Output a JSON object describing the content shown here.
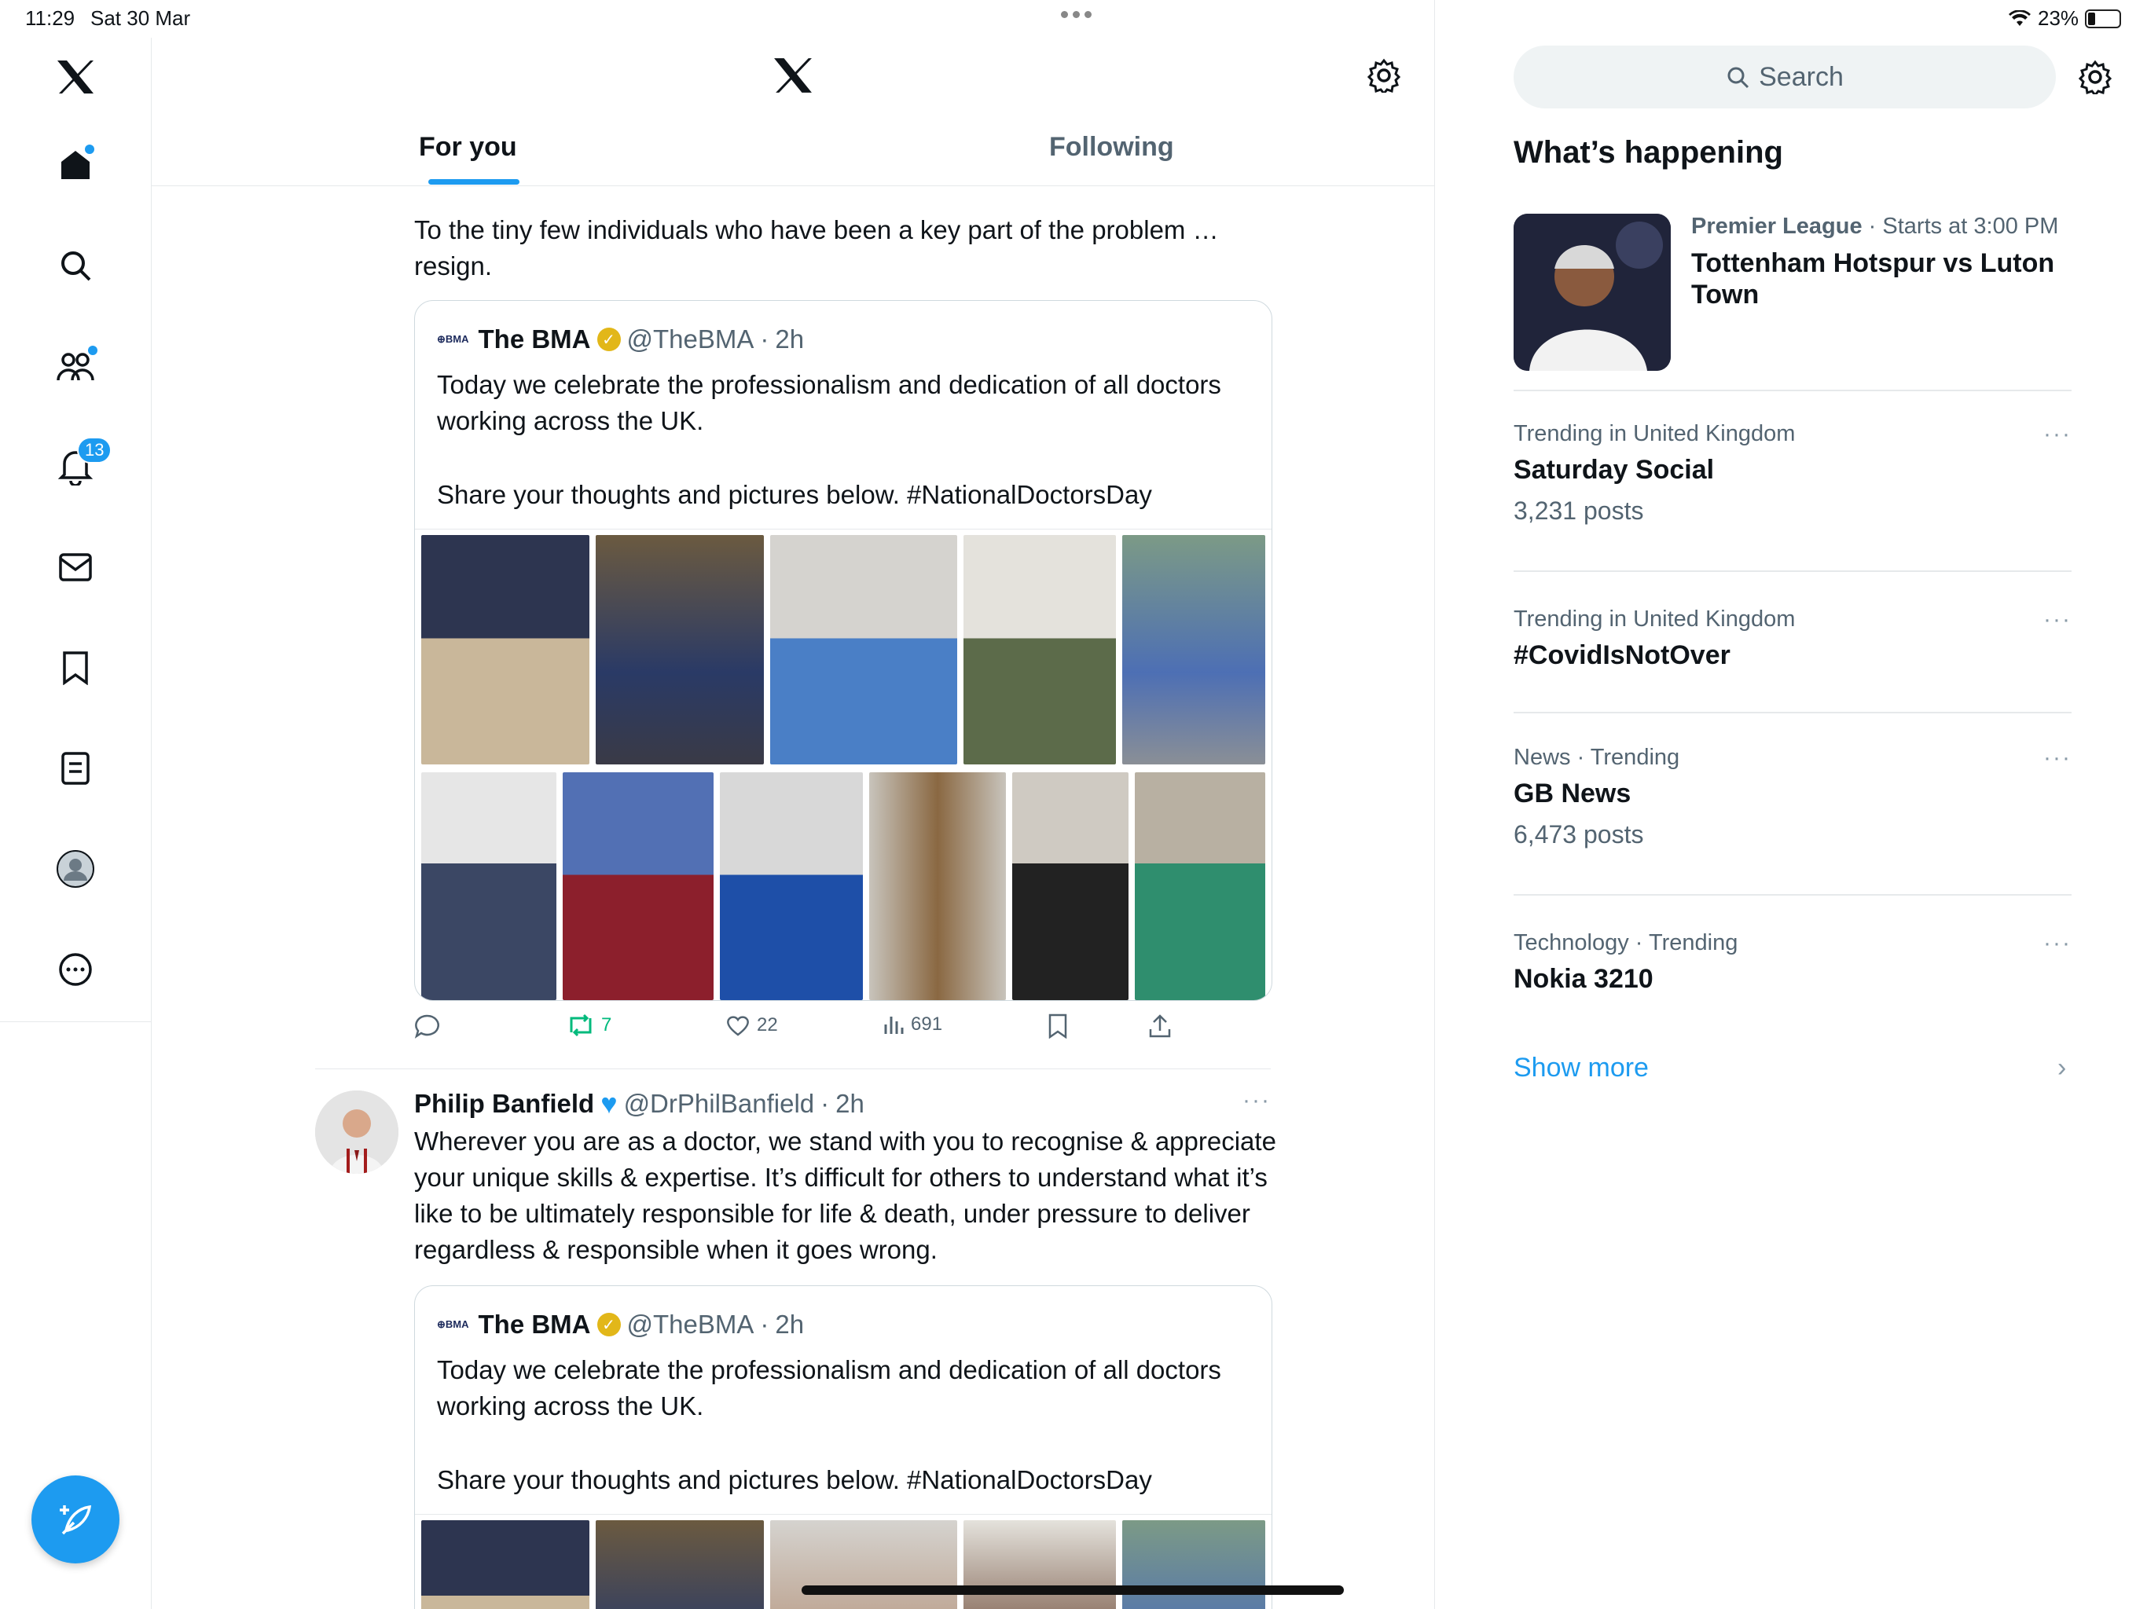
{
  "status_bar": {
    "time": "11:29",
    "date": "Sat 30 Mar",
    "battery": "23%"
  },
  "nav": {
    "items": [
      "home",
      "explore",
      "communities",
      "notifications",
      "messages",
      "bookmarks",
      "lists",
      "profile",
      "more"
    ],
    "notifications_badge": "13"
  },
  "header": {
    "tab_for_you": "For you",
    "tab_following": "Following"
  },
  "feed": {
    "post1": {
      "text": "To the tiny few individuals who have been a key part of the problem … resign.",
      "quote": {
        "name": "The BMA",
        "handle": "@TheBMA",
        "time": "2h",
        "line1": "Today we celebrate the professionalism and dedication of all doctors working across the UK.",
        "line2": "Share your thoughts and pictures below. #NationalDoctorsDay"
      },
      "retweets": "7",
      "likes": "22",
      "views": "691"
    },
    "post2": {
      "name": "Philip Banfield",
      "handle": "@DrPhilBanfield",
      "time": "2h",
      "text": "Wherever you are as a doctor, we stand with you to recognise  & appreciate your unique skills & expertise. It’s difficult for others to understand what it’s like to be ultimately responsible for life & death, under pressure to deliver regardless & responsible when it goes wrong.",
      "quote": {
        "name": "The BMA",
        "handle": "@TheBMA",
        "time": "2h",
        "line1": "Today we celebrate the professionalism and dedication of all doctors working across the UK.",
        "line2": "Share your thoughts and pictures below. #NationalDoctorsDay"
      }
    }
  },
  "sidebar": {
    "search_placeholder": "Search",
    "heading": "What’s happening",
    "featured": {
      "category": "Premier League",
      "meta": " · Starts at 3:00 PM",
      "title": "Tottenham Hotspur vs Luton Town"
    },
    "trends": [
      {
        "meta": "Trending in United Kingdom",
        "title": "Saturday Social",
        "count": "3,231 posts"
      },
      {
        "meta": "Trending in United Kingdom",
        "title": "#CovidIsNotOver",
        "count": ""
      },
      {
        "meta": "News · Trending",
        "title": "GB News",
        "count": "6,473 posts"
      },
      {
        "meta": "Technology · Trending",
        "title": "Nokia 3210",
        "count": ""
      }
    ],
    "show_more": "Show more"
  },
  "colors": {
    "accent": "#1d9bf0",
    "retweet": "#00ba7c",
    "verified_gold": "#e2b719",
    "verified_blue": "#1d9bf0"
  }
}
